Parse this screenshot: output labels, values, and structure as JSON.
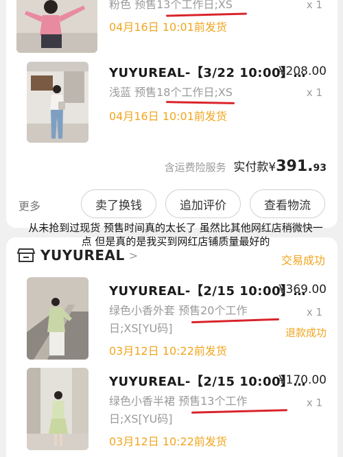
{
  "orders_top": [
    {
      "variant": "粉色 预售13个工作日;XS",
      "qty": "x 1",
      "ship": "04月16日 10:01前发货"
    },
    {
      "title": "YUYUREAL-【3/22 10:00】…",
      "price": "¥208.00",
      "variant": "浅蓝 预售18个工作日;XS",
      "qty": "x 1",
      "ship": "04月16日 10:01前发货"
    }
  ],
  "summary": {
    "note": "含运费险服务",
    "paid_label": "实付款",
    "currency": "¥",
    "amount_int": "391.",
    "amount_dec": "93"
  },
  "actions": {
    "more": "更多",
    "buttons": [
      "卖了换钱",
      "追加评价",
      "查看物流"
    ]
  },
  "overlay_text": "从未抢到过现货 预售时间真的太长了 虽然比其他网红店稍微快一点 但是真的是我买到网红店铺质量最好的",
  "store": {
    "name": "YUYUREAL",
    "chevron": ">",
    "status": "交易成功"
  },
  "orders_bottom": [
    {
      "title": "YUYUREAL-【2/15 10:00】…",
      "price": "¥369.00",
      "variant": "绿色小香外套 预售20个工作日;XS[YU码]",
      "qty": "x 1",
      "refund": "退款成功",
      "ship": "03月12日 10:22前发货"
    },
    {
      "title": "YUYUREAL-【2/15 10:00】…",
      "price": "¥170.00",
      "variant": "绿色小香半裙 预售13个工作日;XS[YU码]",
      "qty": "x 1",
      "ship": "03月12日 10:22前发货"
    }
  ],
  "colors": {
    "accent_orange": "#f0a51e",
    "underline_red": "#d9232a"
  }
}
